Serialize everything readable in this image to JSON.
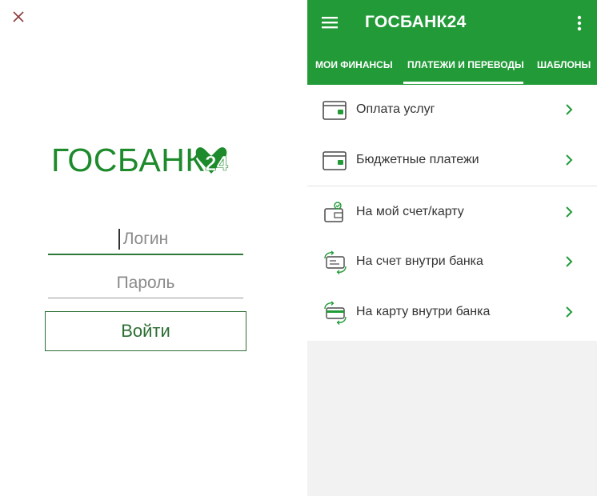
{
  "login": {
    "logo_text": "ГОСБАНК",
    "logo_number": "24",
    "login_placeholder": "Логин",
    "password_placeholder": "Пароль",
    "submit_label": "Войти"
  },
  "app": {
    "title": "ГОСБАНК24",
    "tabs": [
      {
        "label": "МОИ ФИНАНСЫ"
      },
      {
        "label": "ПЛАТЕЖИ И ПЕРЕВОДЫ",
        "active": true
      },
      {
        "label": "ШАБЛОНЫ"
      }
    ],
    "payments": [
      {
        "label": "Оплата услуг",
        "icon": "card-reader-icon"
      },
      {
        "label": "Бюджетные платежи",
        "icon": "card-reader-icon"
      },
      {
        "label": "На мой счет/карту",
        "icon": "wallet-check-icon"
      },
      {
        "label": "На счет внутри банка",
        "icon": "account-transfer-icon"
      },
      {
        "label": "На карту внутри банка",
        "icon": "card-transfer-icon"
      }
    ]
  },
  "colors": {
    "brand_green": "#229a38",
    "logo_green": "#1d8a2b",
    "button_border": "#2c6e33"
  }
}
